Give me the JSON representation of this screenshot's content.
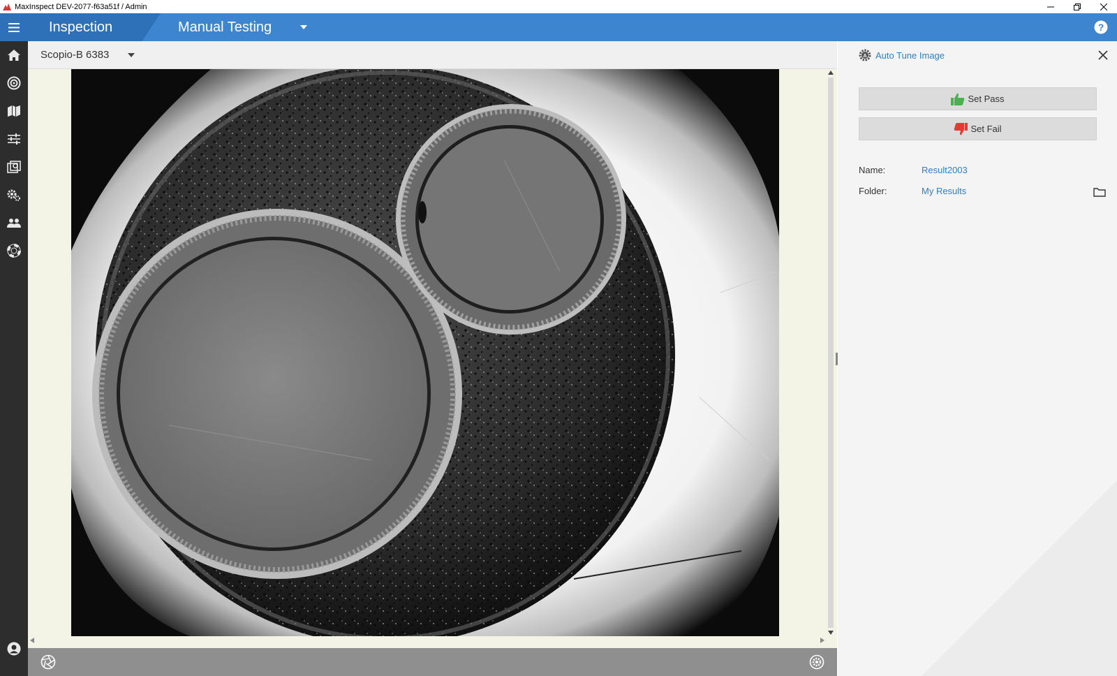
{
  "window": {
    "title": "MaxInspect DEV-2077-f63a51f / Admin",
    "controls": [
      "minimize",
      "restore",
      "close"
    ]
  },
  "header": {
    "section": "Inspection",
    "mode": "Manual Testing",
    "help_icon": "help-icon"
  },
  "left_nav": {
    "items": [
      {
        "name": "home",
        "icon": "home-icon"
      },
      {
        "name": "target",
        "icon": "target-icon"
      },
      {
        "name": "map",
        "icon": "map-icon"
      },
      {
        "name": "adjustments",
        "icon": "sliders-icon"
      },
      {
        "name": "gallery",
        "icon": "gallery-icon"
      },
      {
        "name": "settings",
        "icon": "gears-icon"
      },
      {
        "name": "users",
        "icon": "users-icon"
      },
      {
        "name": "support",
        "icon": "lifebuoy-icon"
      }
    ],
    "account_icon": "user-icon"
  },
  "toolbar": {
    "device": "Scopio-B 6383"
  },
  "viewer": {
    "image": "fiber-end-face-microscope-image"
  },
  "statusbar": {
    "left_icon": "aperture-icon",
    "right_icon": "gear-icon"
  },
  "panel": {
    "auto_tune_label": "Auto Tune Image",
    "set_pass_label": "Set Pass",
    "set_fail_label": "Set Fail",
    "name_label": "Name:",
    "name_value": "Result2003",
    "folder_label": "Folder:",
    "folder_value": "My Results"
  },
  "colors": {
    "header": "#3d86cf",
    "header_dark": "#2e71b8",
    "nav": "#2d2d2d",
    "link": "#2f7fc8",
    "pass": "#4caf50",
    "fail": "#e53935"
  }
}
